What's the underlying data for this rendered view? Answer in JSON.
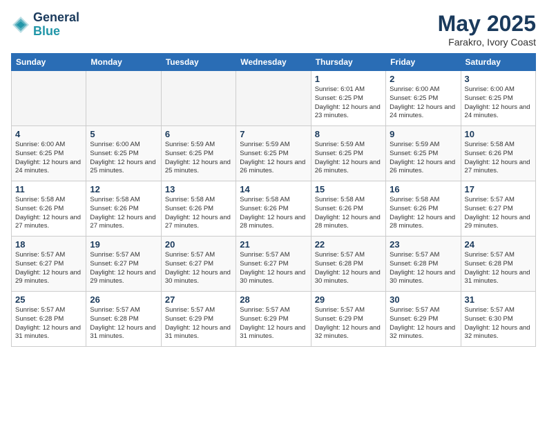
{
  "header": {
    "logo_line1": "General",
    "logo_line2": "Blue",
    "month": "May 2025",
    "location": "Farakro, Ivory Coast"
  },
  "weekdays": [
    "Sunday",
    "Monday",
    "Tuesday",
    "Wednesday",
    "Thursday",
    "Friday",
    "Saturday"
  ],
  "weeks": [
    [
      {
        "day": "",
        "empty": true
      },
      {
        "day": "",
        "empty": true
      },
      {
        "day": "",
        "empty": true
      },
      {
        "day": "",
        "empty": true
      },
      {
        "day": "1",
        "sunrise": "6:01 AM",
        "sunset": "6:25 PM",
        "daylight": "12 hours and 23 minutes."
      },
      {
        "day": "2",
        "sunrise": "6:00 AM",
        "sunset": "6:25 PM",
        "daylight": "12 hours and 24 minutes."
      },
      {
        "day": "3",
        "sunrise": "6:00 AM",
        "sunset": "6:25 PM",
        "daylight": "12 hours and 24 minutes."
      }
    ],
    [
      {
        "day": "4",
        "sunrise": "6:00 AM",
        "sunset": "6:25 PM",
        "daylight": "12 hours and 24 minutes."
      },
      {
        "day": "5",
        "sunrise": "6:00 AM",
        "sunset": "6:25 PM",
        "daylight": "12 hours and 25 minutes."
      },
      {
        "day": "6",
        "sunrise": "5:59 AM",
        "sunset": "6:25 PM",
        "daylight": "12 hours and 25 minutes."
      },
      {
        "day": "7",
        "sunrise": "5:59 AM",
        "sunset": "6:25 PM",
        "daylight": "12 hours and 26 minutes."
      },
      {
        "day": "8",
        "sunrise": "5:59 AM",
        "sunset": "6:25 PM",
        "daylight": "12 hours and 26 minutes."
      },
      {
        "day": "9",
        "sunrise": "5:59 AM",
        "sunset": "6:25 PM",
        "daylight": "12 hours and 26 minutes."
      },
      {
        "day": "10",
        "sunrise": "5:58 AM",
        "sunset": "6:26 PM",
        "daylight": "12 hours and 27 minutes."
      }
    ],
    [
      {
        "day": "11",
        "sunrise": "5:58 AM",
        "sunset": "6:26 PM",
        "daylight": "12 hours and 27 minutes."
      },
      {
        "day": "12",
        "sunrise": "5:58 AM",
        "sunset": "6:26 PM",
        "daylight": "12 hours and 27 minutes."
      },
      {
        "day": "13",
        "sunrise": "5:58 AM",
        "sunset": "6:26 PM",
        "daylight": "12 hours and 27 minutes."
      },
      {
        "day": "14",
        "sunrise": "5:58 AM",
        "sunset": "6:26 PM",
        "daylight": "12 hours and 28 minutes."
      },
      {
        "day": "15",
        "sunrise": "5:58 AM",
        "sunset": "6:26 PM",
        "daylight": "12 hours and 28 minutes."
      },
      {
        "day": "16",
        "sunrise": "5:58 AM",
        "sunset": "6:26 PM",
        "daylight": "12 hours and 28 minutes."
      },
      {
        "day": "17",
        "sunrise": "5:57 AM",
        "sunset": "6:27 PM",
        "daylight": "12 hours and 29 minutes."
      }
    ],
    [
      {
        "day": "18",
        "sunrise": "5:57 AM",
        "sunset": "6:27 PM",
        "daylight": "12 hours and 29 minutes."
      },
      {
        "day": "19",
        "sunrise": "5:57 AM",
        "sunset": "6:27 PM",
        "daylight": "12 hours and 29 minutes."
      },
      {
        "day": "20",
        "sunrise": "5:57 AM",
        "sunset": "6:27 PM",
        "daylight": "12 hours and 30 minutes."
      },
      {
        "day": "21",
        "sunrise": "5:57 AM",
        "sunset": "6:27 PM",
        "daylight": "12 hours and 30 minutes."
      },
      {
        "day": "22",
        "sunrise": "5:57 AM",
        "sunset": "6:28 PM",
        "daylight": "12 hours and 30 minutes."
      },
      {
        "day": "23",
        "sunrise": "5:57 AM",
        "sunset": "6:28 PM",
        "daylight": "12 hours and 30 minutes."
      },
      {
        "day": "24",
        "sunrise": "5:57 AM",
        "sunset": "6:28 PM",
        "daylight": "12 hours and 31 minutes."
      }
    ],
    [
      {
        "day": "25",
        "sunrise": "5:57 AM",
        "sunset": "6:28 PM",
        "daylight": "12 hours and 31 minutes."
      },
      {
        "day": "26",
        "sunrise": "5:57 AM",
        "sunset": "6:28 PM",
        "daylight": "12 hours and 31 minutes."
      },
      {
        "day": "27",
        "sunrise": "5:57 AM",
        "sunset": "6:29 PM",
        "daylight": "12 hours and 31 minutes."
      },
      {
        "day": "28",
        "sunrise": "5:57 AM",
        "sunset": "6:29 PM",
        "daylight": "12 hours and 31 minutes."
      },
      {
        "day": "29",
        "sunrise": "5:57 AM",
        "sunset": "6:29 PM",
        "daylight": "12 hours and 32 minutes."
      },
      {
        "day": "30",
        "sunrise": "5:57 AM",
        "sunset": "6:29 PM",
        "daylight": "12 hours and 32 minutes."
      },
      {
        "day": "31",
        "sunrise": "5:57 AM",
        "sunset": "6:30 PM",
        "daylight": "12 hours and 32 minutes."
      }
    ]
  ]
}
